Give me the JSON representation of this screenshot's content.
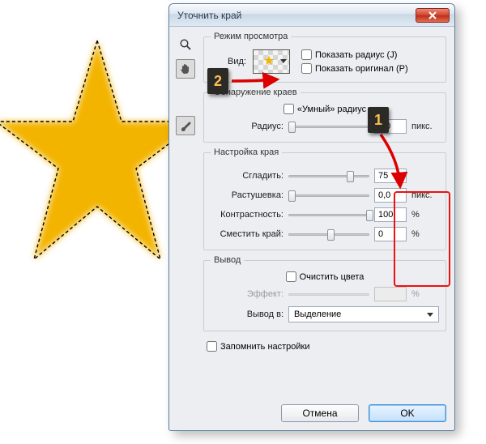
{
  "dialog": {
    "title": "Уточнить край"
  },
  "view_mode": {
    "legend": "Режим просмотра",
    "label": "Вид:",
    "show_radius": "Показать радиус (J)",
    "show_original": "Показать оригинал (P)"
  },
  "edge_detection": {
    "legend": "Обнаружение краев",
    "smart_radius": "«Умный» радиус",
    "radius_label": "Радиус:",
    "radius_value": "0,0",
    "radius_unit": "пикс."
  },
  "adjust": {
    "legend": "Настройка края",
    "smooth_label": "Сгладить:",
    "smooth_value": "75",
    "feather_label": "Растушевка:",
    "feather_value": "0,0",
    "feather_unit": "пикс.",
    "contrast_label": "Контрастность:",
    "contrast_value": "100",
    "contrast_unit": "%",
    "shift_label": "Сместить край:",
    "shift_value": "0",
    "shift_unit": "%"
  },
  "output": {
    "legend": "Вывод",
    "decontaminate": "Очистить цвета",
    "effect_label": "Эффект:",
    "effect_unit": "%",
    "output_to_label": "Вывод в:",
    "output_to_value": "Выделение"
  },
  "remember": "Запомнить настройки",
  "buttons": {
    "cancel": "Отмена",
    "ok": "OK"
  },
  "callouts": {
    "one": "1",
    "two": "2"
  }
}
